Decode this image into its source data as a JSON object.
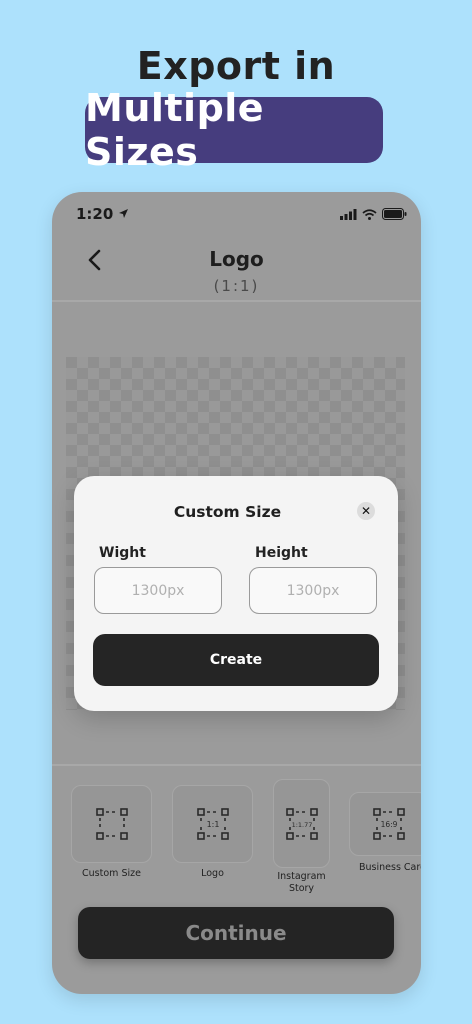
{
  "promo": {
    "headline": "Export in",
    "highlight": "Multiple Sizes"
  },
  "status_bar": {
    "time": "1:20",
    "icons": [
      "location-arrow-icon",
      "cellular-signal-icon",
      "wifi-icon",
      "battery-icon"
    ]
  },
  "nav": {
    "back_icon": "chevron-left-icon",
    "title": "Logo",
    "subtitle": "(1:1)"
  },
  "dialog": {
    "title": "Custom Size",
    "close_icon": "close-icon",
    "width_label": "Wight",
    "width_placeholder": "1300px",
    "height_label": "Height",
    "height_placeholder": "1300px",
    "create_label": "Create"
  },
  "presets": [
    {
      "label": "Custom Size",
      "ratio": ""
    },
    {
      "label": "Logo",
      "ratio": "1:1"
    },
    {
      "label": "Instagram Story",
      "ratio": "1:1.77"
    },
    {
      "label": "Business Card",
      "ratio": "16:9"
    }
  ],
  "continue_label": "Continue",
  "colors": {
    "background": "#ade1fc",
    "highlight_pill": "#463d7e",
    "dark_button": "#252525"
  }
}
